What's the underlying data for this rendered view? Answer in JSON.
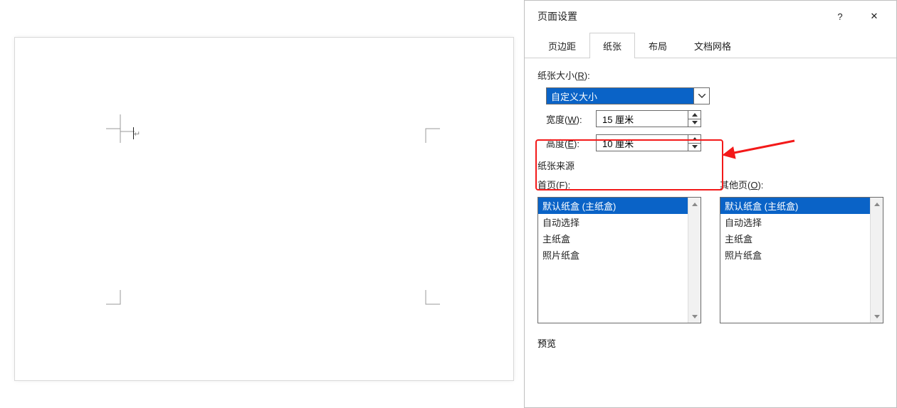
{
  "dialog": {
    "title": "页面设置",
    "tabs": [
      "页边距",
      "纸张",
      "布局",
      "文档网格"
    ],
    "active_tab": 1,
    "size_section_label_pre": "纸张大小(",
    "size_section_label_key": "R",
    "size_section_label_post": "):",
    "size_combo_value": "自定义大小",
    "width_label_pre": "宽度(",
    "width_label_key": "W",
    "width_label_post": "):",
    "width_value": "15 厘米",
    "height_label_pre": "高度(",
    "height_label_key": "E",
    "height_label_post": "):",
    "height_value": "10 厘米",
    "source_label": "纸张来源",
    "first_page_label_pre": "首页(",
    "first_page_label_key": "F",
    "first_page_label_post": "):",
    "other_pages_label_pre": "其他页(",
    "other_pages_label_key": "O",
    "other_pages_label_post": "):",
    "first_page_items": [
      "默认纸盒 (主纸盒)",
      "自动选择",
      "主纸盒",
      "照片纸盒"
    ],
    "other_pages_items": [
      "默认纸盒 (主纸盒)",
      "自动选择",
      "主纸盒",
      "照片纸盒"
    ],
    "preview_label": "预览"
  },
  "glyphs": {
    "help": "?",
    "close": "✕",
    "return": "↵"
  }
}
